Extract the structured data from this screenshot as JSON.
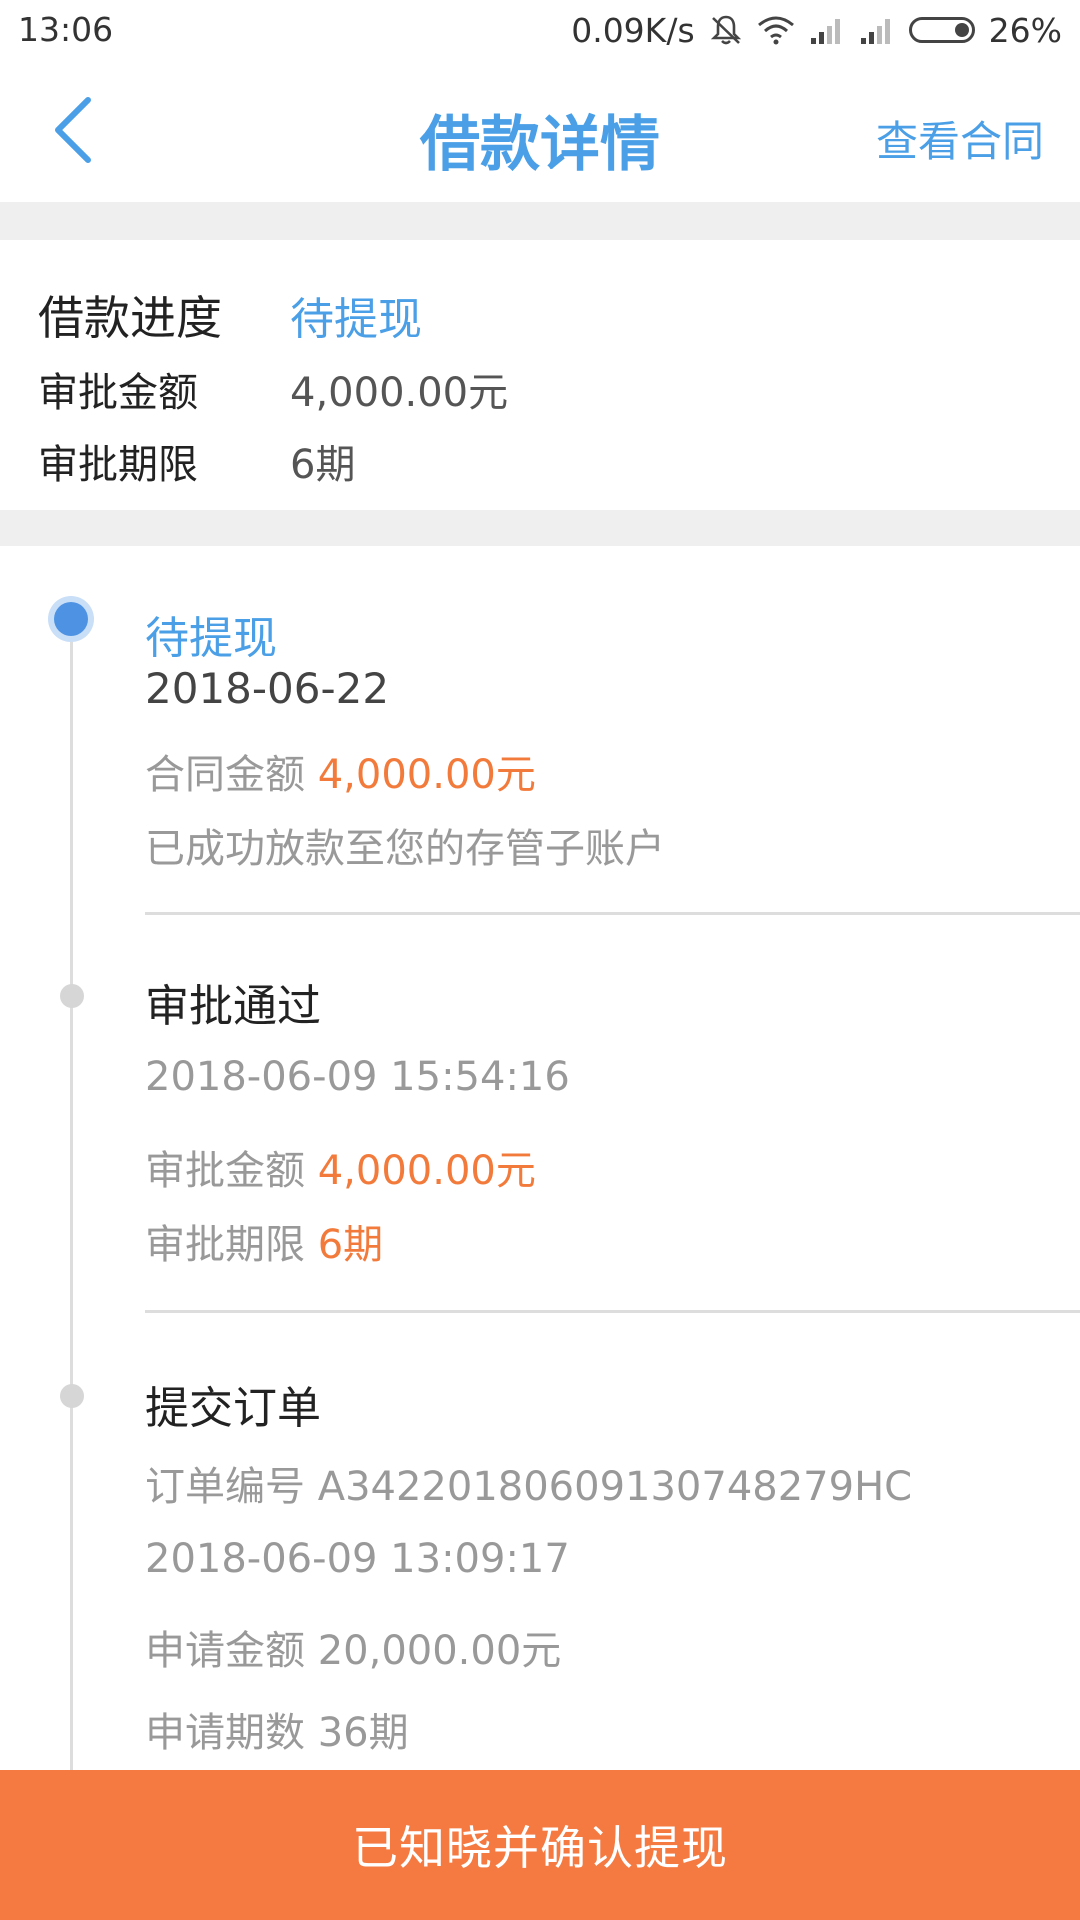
{
  "status_bar": {
    "time": "13:06",
    "network_speed": "0.09K/s",
    "battery_percent": "26%",
    "icons": [
      "mute-bell-icon",
      "wifi-icon",
      "signal-icon",
      "signal-icon",
      "battery-icon"
    ]
  },
  "header": {
    "title": "借款详情",
    "right_action": "查看合同",
    "back_icon": "chevron-left-icon"
  },
  "summary": {
    "progress_label": "借款进度",
    "progress_value": "待提现",
    "amount_label": "审批金额",
    "amount_value": "4,000.00元",
    "term_label": "审批期限",
    "term_value": "6期"
  },
  "timeline": {
    "step1": {
      "title": "待提现",
      "date": "2018-06-22",
      "contract_label": "合同金额",
      "contract_value": "4,000.00元",
      "note": "已成功放款至您的存管子账户"
    },
    "step2": {
      "title": "审批通过",
      "datetime": "2018-06-09 15:54:16",
      "amount_label": "审批金额",
      "amount_value": "4,000.00元",
      "term_label": "审批期限",
      "term_value": "6期"
    },
    "step3": {
      "title": "提交订单",
      "order_label": "订单编号",
      "order_value": "A34220180609130748279HC",
      "datetime": "2018-06-09 13:09:17",
      "apply_amount_label": "申请金额",
      "apply_amount_value": "20,000.00元",
      "apply_term_label": "申请期数",
      "apply_term_value": "36期"
    }
  },
  "footer": {
    "confirm_label": "已知晓并确认提现"
  },
  "colors": {
    "accent_blue": "#4a9fe6",
    "highlight_orange": "#f27b3c",
    "button_orange": "#f47a42",
    "divider_gray": "#efefef"
  }
}
